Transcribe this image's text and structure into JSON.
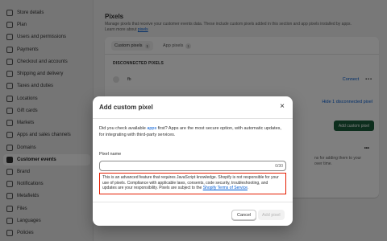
{
  "sidebar": {
    "items": [
      {
        "label": "Store details",
        "icon": "store-icon"
      },
      {
        "label": "Plan",
        "icon": "plan-icon"
      },
      {
        "label": "Users and permissions",
        "icon": "user-icon"
      },
      {
        "label": "Payments",
        "icon": "payments-icon"
      },
      {
        "label": "Checkout and accounts",
        "icon": "checkout-icon"
      },
      {
        "label": "Shipping and delivery",
        "icon": "truck-icon"
      },
      {
        "label": "Taxes and duties",
        "icon": "taxes-icon"
      },
      {
        "label": "Locations",
        "icon": "location-icon"
      },
      {
        "label": "Gift cards",
        "icon": "gift-card-icon"
      },
      {
        "label": "Markets",
        "icon": "globe-icon"
      },
      {
        "label": "Apps and sales channels",
        "icon": "apps-icon"
      },
      {
        "label": "Domains",
        "icon": "domain-icon"
      },
      {
        "label": "Customer events",
        "icon": "events-icon",
        "active": true
      },
      {
        "label": "Brand",
        "icon": "brand-icon"
      },
      {
        "label": "Notifications",
        "icon": "bell-icon"
      },
      {
        "label": "Metafields",
        "icon": "metafields-icon"
      },
      {
        "label": "Files",
        "icon": "file-icon"
      },
      {
        "label": "Languages",
        "icon": "language-icon"
      },
      {
        "label": "Policies",
        "icon": "policies-icon"
      }
    ]
  },
  "main": {
    "title": "Pixels",
    "description": "Manage pixels that receive your customer events data. These include custom pixels added in this section and app pixels installed by apps.",
    "learn_more_prefix": "Learn more about ",
    "learn_more_link": "pixels",
    "tabs": [
      {
        "label": "Custom pixels",
        "count": "1"
      },
      {
        "label": "App pixels",
        "count": "1"
      }
    ],
    "section_heading": "DISCONNECTED PIXELS",
    "pixel": {
      "name": "fb",
      "action": "Connect",
      "menu": "•••"
    },
    "hide_link": "Hide 1 disconnected pixel",
    "add_button": "Add custom pixel",
    "menu2": "•••",
    "side_fragment": "ns for adding them to your\nover time."
  },
  "modal": {
    "title": "Add custom pixel",
    "close": "×",
    "intro_a": "Did you check available ",
    "intro_link": "apps",
    "intro_b": " first? Apps are the most secure option, with automatic updates, for integrating with third-party services.",
    "field_label": "Pixel name",
    "field_value": "",
    "field_count": "0/30",
    "note": "This is an advanced feature that requires JavaScript knowledge. Shopify is not responsible for your use of pixels. Compliance with applicable laws, consents, code security, troubleshooting, and updates are your responsibility. Pixels are subject to the ",
    "note_link": "Shopify Terms of Service",
    "note_end": ".",
    "cancel": "Cancel",
    "add": "Add pixel"
  },
  "colors": {
    "accent_green": "#1a5d3a",
    "link_blue": "#005bd3",
    "note_border_red": "#e51c00"
  }
}
